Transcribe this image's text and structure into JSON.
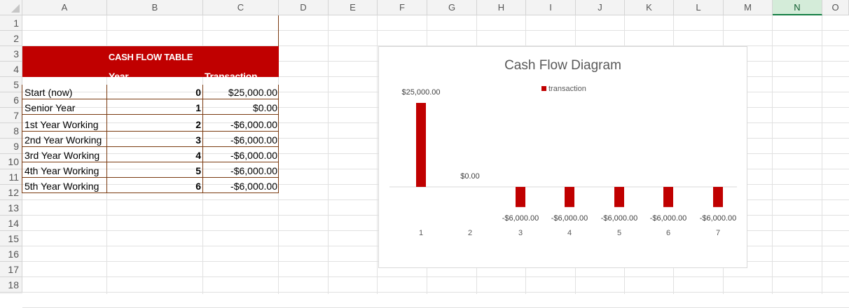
{
  "columns": [
    "A",
    "B",
    "C",
    "D",
    "E",
    "F",
    "G",
    "H",
    "I",
    "J",
    "K",
    "L",
    "M",
    "N",
    "O"
  ],
  "selected_column": "N",
  "rows": [
    "1",
    "2",
    "3",
    "4",
    "5",
    "6",
    "7",
    "8",
    "9",
    "10",
    "11",
    "12",
    "13",
    "14",
    "15",
    "16",
    "17",
    "18"
  ],
  "cash_flow_table": {
    "title": "CASH FLOW TABLE",
    "header_year": "Year",
    "header_transaction": "Transaction",
    "rows": [
      {
        "label": "Start (now)",
        "year": "0",
        "transaction": "$25,000.00"
      },
      {
        "label": "Senior  Year",
        "year": "1",
        "transaction": "$0.00"
      },
      {
        "label": "1st Year Working",
        "year": "2",
        "transaction": "-$6,000.00"
      },
      {
        "label": "2nd Year Working",
        "year": "3",
        "transaction": "-$6,000.00"
      },
      {
        "label": "3rd Year Working",
        "year": "4",
        "transaction": "-$6,000.00"
      },
      {
        "label": "4th Year Working",
        "year": "5",
        "transaction": "-$6,000.00"
      },
      {
        "label": "5th Year Working",
        "year": "6",
        "transaction": "-$6,000.00"
      }
    ]
  },
  "colors": {
    "accent": "#c00000",
    "selected_header_bg": "#d4ecd9",
    "selected_header_border": "#137e43"
  },
  "chart_data": {
    "type": "bar",
    "title": "Cash Flow Diagram",
    "legend": "transaction",
    "legend_placement": "top",
    "categories": [
      "1",
      "2",
      "3",
      "4",
      "5",
      "6",
      "7"
    ],
    "values": [
      25000,
      0,
      -6000,
      -6000,
      -6000,
      -6000,
      -6000
    ],
    "data_labels": [
      "$25,000.00",
      "$0.00",
      "-$6,000.00",
      "-$6,000.00",
      "-$6,000.00",
      "-$6,000.00",
      "-$6,000.00"
    ],
    "ylim": [
      -6000,
      25000
    ],
    "grid": false,
    "color": "#c00000"
  }
}
